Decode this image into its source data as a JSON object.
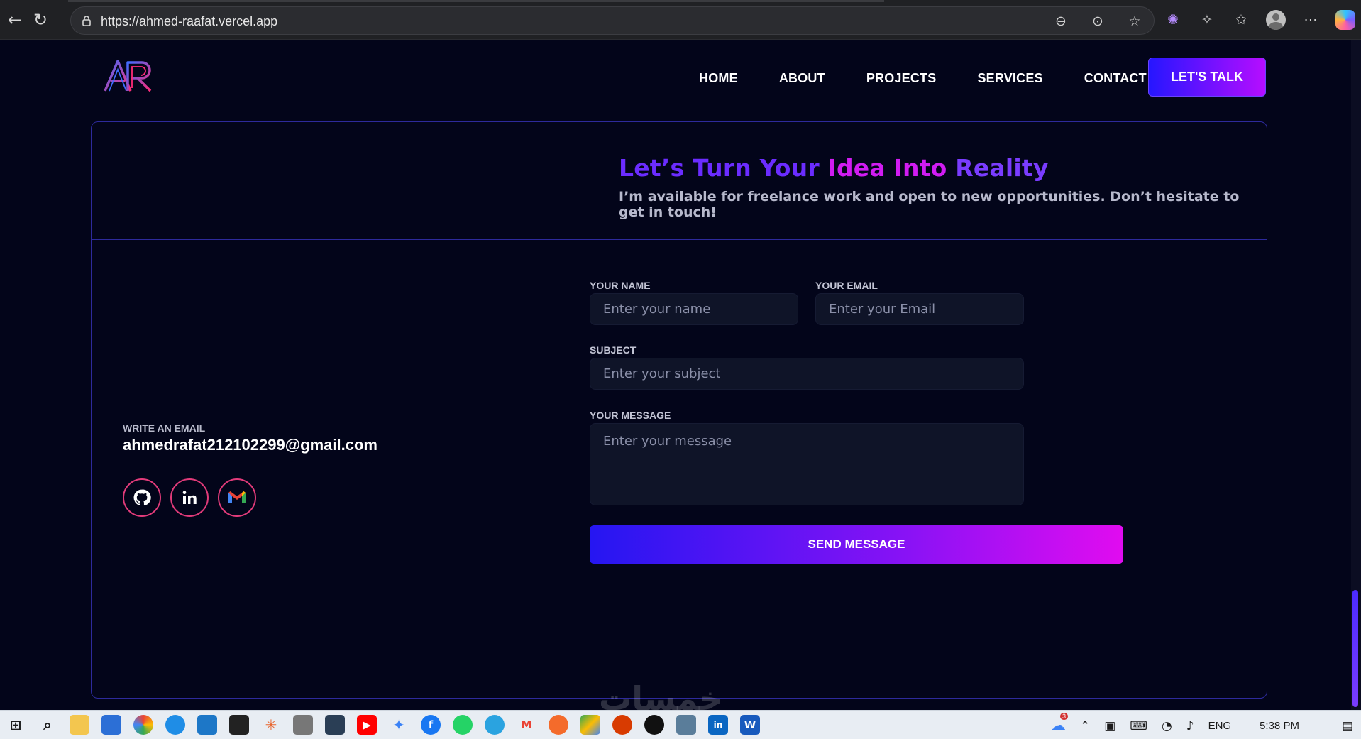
{
  "browser": {
    "url": "https://ahmed-raafat.vercel.app",
    "icons": [
      "back-icon",
      "reload-icon",
      "lock-icon",
      "zoom-out-icon",
      "reader-icon",
      "star-icon",
      "extension-icon",
      "favorites-icon",
      "profile-icon",
      "more-icon",
      "copilot-icon"
    ]
  },
  "nav": {
    "logo": "AR",
    "items": [
      "HOME",
      "ABOUT",
      "PROJECTS",
      "SERVICES",
      "CONTACT"
    ],
    "cta": "LET'S TALK"
  },
  "hero": {
    "title_part1": "Let’s Turn Your ",
    "title_part2": "Idea Into",
    "title_part3": " Reality",
    "subtitle": "I’m available for freelance work and open to new opportunities. Don’t hesitate to get in touch!"
  },
  "contact": {
    "email_label": "WRITE AN EMAIL",
    "email_value": "ahmedrafat212102299@gmail.com",
    "socials": [
      "github-icon",
      "linkedin-icon",
      "gmail-icon"
    ]
  },
  "form": {
    "name_label": "YOUR NAME",
    "name_placeholder": "Enter your name",
    "email_label": "YOUR EMAIL",
    "email_placeholder": "Enter your Email",
    "subject_label": "SUBJECT",
    "subject_placeholder": "Enter your subject",
    "message_label": "YOUR MESSAGE",
    "message_placeholder": "Enter your message",
    "submit": "SEND MESSAGE"
  },
  "watermark": "خمسات",
  "taskbar": {
    "language": "ENG",
    "time": "5:38 PM",
    "weather_badge": "3",
    "word_letter": "W",
    "linkedin_letter": "in"
  },
  "colors": {
    "accent_blue": "#2616ff",
    "accent_magenta": "#e10cf0",
    "background": "#03051a",
    "border": "#2d2a9c"
  }
}
